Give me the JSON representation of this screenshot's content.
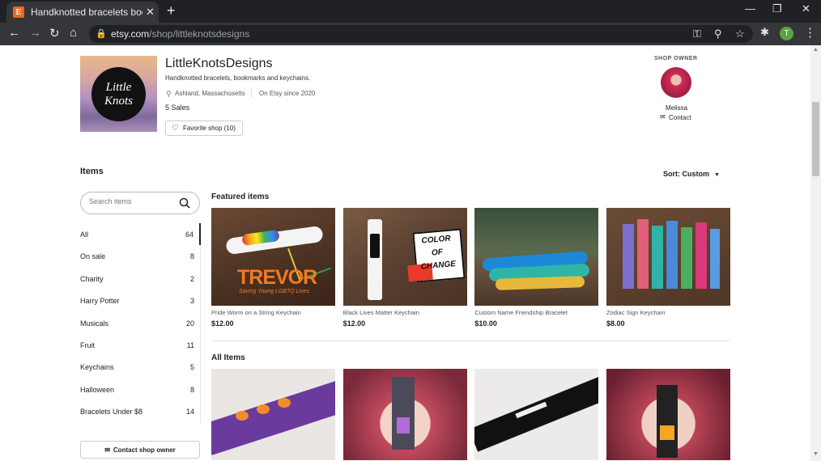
{
  "browser": {
    "tab_title": "Handknotted bracelets bookmarks",
    "favicon": "E",
    "url_domain": "etsy.com",
    "url_path": "/shop/littleknotsdesigns",
    "profile_initial": "T"
  },
  "shop": {
    "logo_text": "Little Knots",
    "name": "LittleKnotsDesigns",
    "tagline": "Handknotted bracelets, bookmarks and keychains.",
    "location": "Ashland, Massachusetts",
    "since": "On Etsy since 2020",
    "sales": "5 Sales",
    "favorite_label": "Favorite shop (10)"
  },
  "owner": {
    "label": "SHOP OWNER",
    "name": "Melissa",
    "contact": "Contact"
  },
  "items_heading": "Items",
  "sort_label": "Sort: Custom",
  "search": {
    "placeholder": "Search items"
  },
  "categories": [
    {
      "label": "All",
      "count": "64"
    },
    {
      "label": "On sale",
      "count": "8"
    },
    {
      "label": "Charity",
      "count": "2"
    },
    {
      "label": "Harry Potter",
      "count": "3"
    },
    {
      "label": "Musicals",
      "count": "20"
    },
    {
      "label": "Fruit",
      "count": "11"
    },
    {
      "label": "Keychains",
      "count": "5"
    },
    {
      "label": "Halloween",
      "count": "8"
    },
    {
      "label": "Bracelets Under $8",
      "count": "14"
    }
  ],
  "contact_owner_button": "Contact shop owner",
  "featured": {
    "title": "Featured items",
    "items": [
      {
        "title": "Pride Worm on a String Keychain",
        "price": "$12.00",
        "overlay": "TREVOR",
        "overlay_sub": "Saving Young LGBTQ Lives"
      },
      {
        "title": "Black Lives Matter Keychain",
        "price": "$12.00",
        "overlay": "COLOR OF CHANGE"
      },
      {
        "title": "Custom Name Friendship Bracelet",
        "price": "$10.00"
      },
      {
        "title": "Zodiac Sign Keychain",
        "price": "$8.00"
      }
    ]
  },
  "all_items": {
    "title": "All Items"
  }
}
